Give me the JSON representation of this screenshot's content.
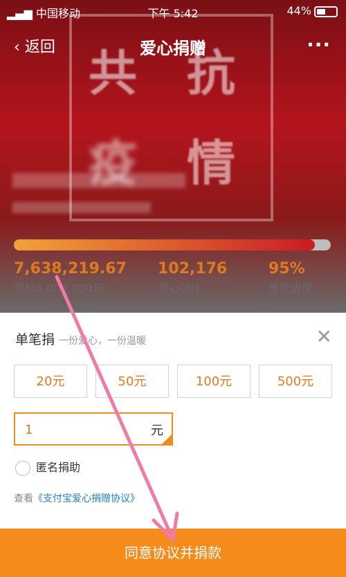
{
  "status_bar": {
    "carrier": "中国移动",
    "time": "下午 5:42",
    "battery": "44%"
  },
  "nav": {
    "back_label": "返回",
    "title": "爱心捐赠",
    "more_icon": "more-icon"
  },
  "banner": {
    "chars": [
      "共",
      "抗",
      "疫",
      "情"
    ]
  },
  "progress": {
    "fraction": 0.95
  },
  "stats": [
    {
      "value": "7,638,219.67",
      "label": "目标8,000,000元"
    },
    {
      "value": "102,176",
      "label": "爱心(份)"
    },
    {
      "value": "95%",
      "label": "筹款进度"
    }
  ],
  "sheet": {
    "title": "单笔捐",
    "subtitle": "一份爱心，一份温暖",
    "amounts": [
      "20元",
      "50元",
      "100元",
      "500元"
    ],
    "input_value": "1",
    "unit": "元",
    "anonymous_label": "匿名捐助",
    "agreement_prefix": "查看",
    "agreement_link": "《支付宝爱心捐赠协议》"
  },
  "cta_label": "同意协议并捐款",
  "colors": {
    "accent": "#f58b1b",
    "link": "#1f7fd1",
    "annotation_arrow": "#f07aa8"
  }
}
